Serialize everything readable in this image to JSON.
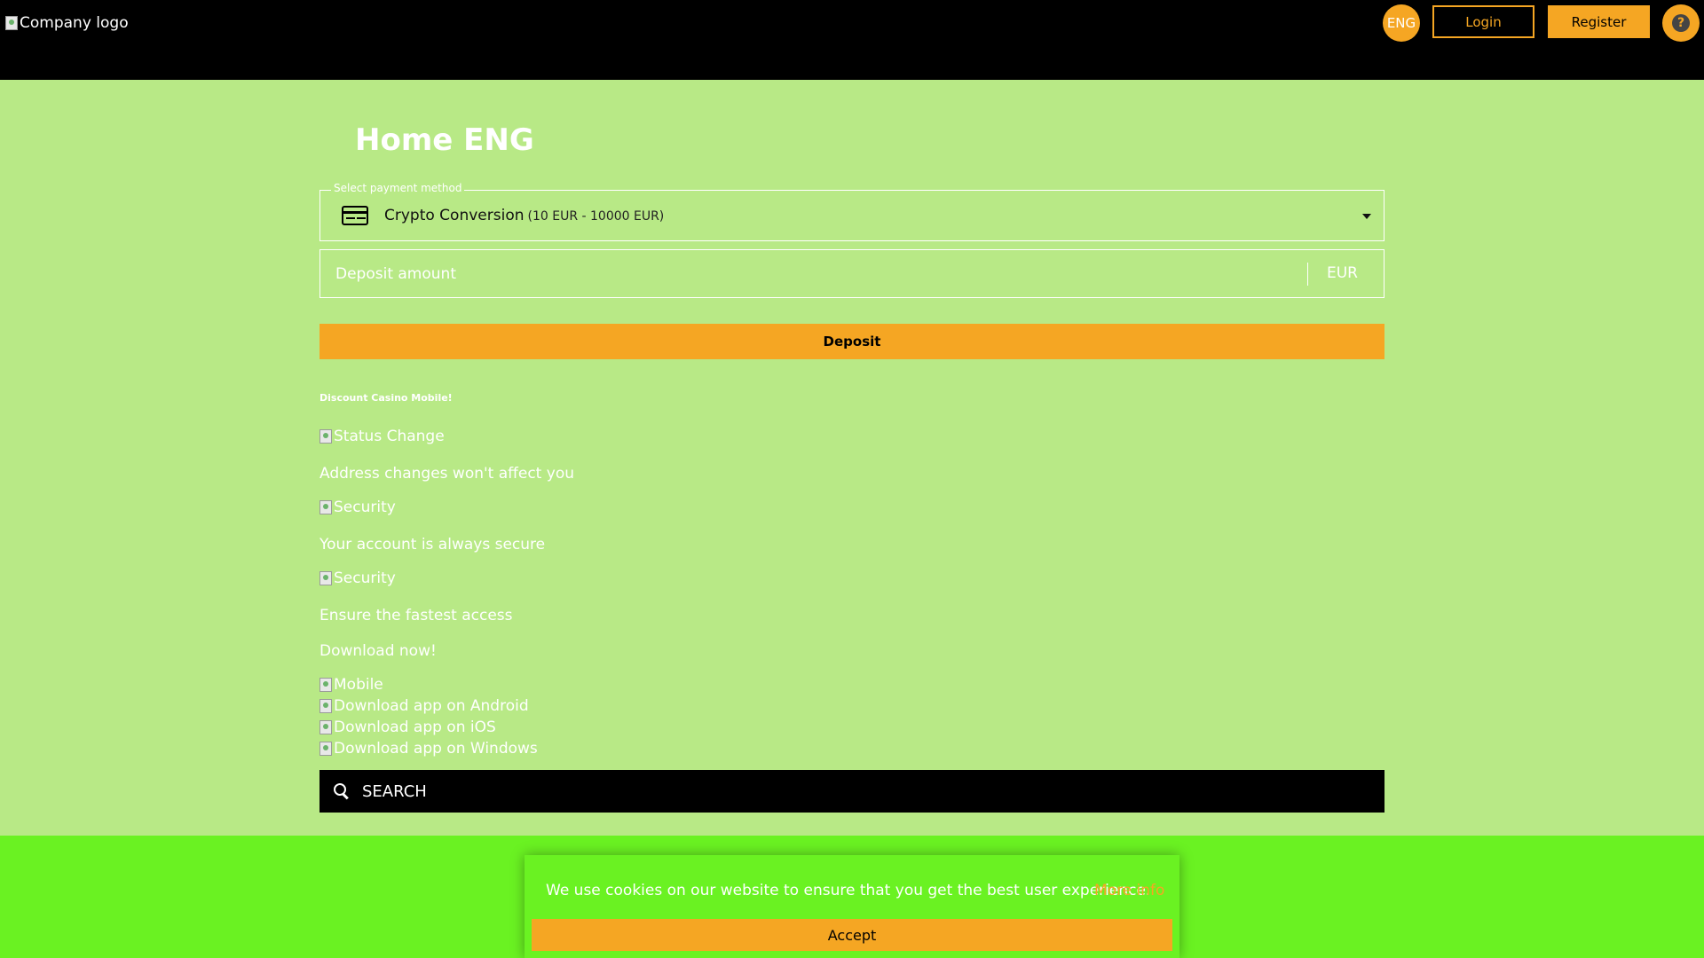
{
  "header": {
    "logo_alt": "Company logo",
    "lang_label": "ENG",
    "login_label": "Login",
    "register_label": "Register",
    "help_label": "?"
  },
  "main": {
    "title": "Home ENG",
    "payment": {
      "legend": "Select payment method",
      "method_name": "Crypto Conversion",
      "method_range": "(10 EUR - 10000 EUR)"
    },
    "amount": {
      "placeholder": "Deposit amount",
      "currency": "EUR"
    },
    "deposit_label": "Deposit",
    "promo": "Discount Casino Mobile!",
    "features": [
      {
        "img_alt": "Status Change",
        "text": "Address changes won't affect you"
      },
      {
        "img_alt": "Security",
        "text": "Your account is always secure"
      },
      {
        "img_alt": "Security",
        "text": "Ensure the fastest access"
      }
    ],
    "download_title": "Download now!",
    "downloads": [
      "Mobile",
      "Download app on Android",
      "Download app on iOS",
      "Download app on Windows"
    ],
    "search_placeholder": "SEARCH"
  },
  "cookie": {
    "text": "We use cookies on our website to ensure that you get the best user experience.",
    "more_label": "More info",
    "accept_label": "Accept"
  },
  "colors": {
    "header_bg": "#000000",
    "page_bg": "#b8e986",
    "accent": "#f5a623",
    "footer_bg": "#6af222"
  }
}
